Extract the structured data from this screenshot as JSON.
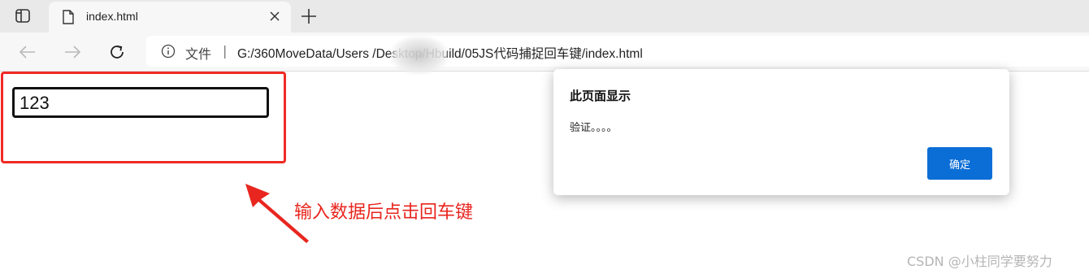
{
  "browser": {
    "tab": {
      "title": "index.html",
      "icon": "file-icon"
    },
    "toolbar": {
      "back_icon": "arrow-left-icon",
      "forward_icon": "arrow-right-icon",
      "reload_icon": "reload-icon"
    },
    "address": {
      "scheme_label": "文件",
      "separator": "|",
      "url": "G:/360MoveData/Users          /Desktop/Hbuild/05JS代码捕捉回车键/index.html"
    }
  },
  "page": {
    "input_value": "123",
    "annotation": "输入数据后点击回车键",
    "highlight_color": "#f02a24"
  },
  "dialog": {
    "title": "此页面显示",
    "message": "验证。。。。",
    "ok_label": "确定",
    "ok_color": "#0b6ed6"
  },
  "watermark": "CSDN @小柱同学要努力"
}
